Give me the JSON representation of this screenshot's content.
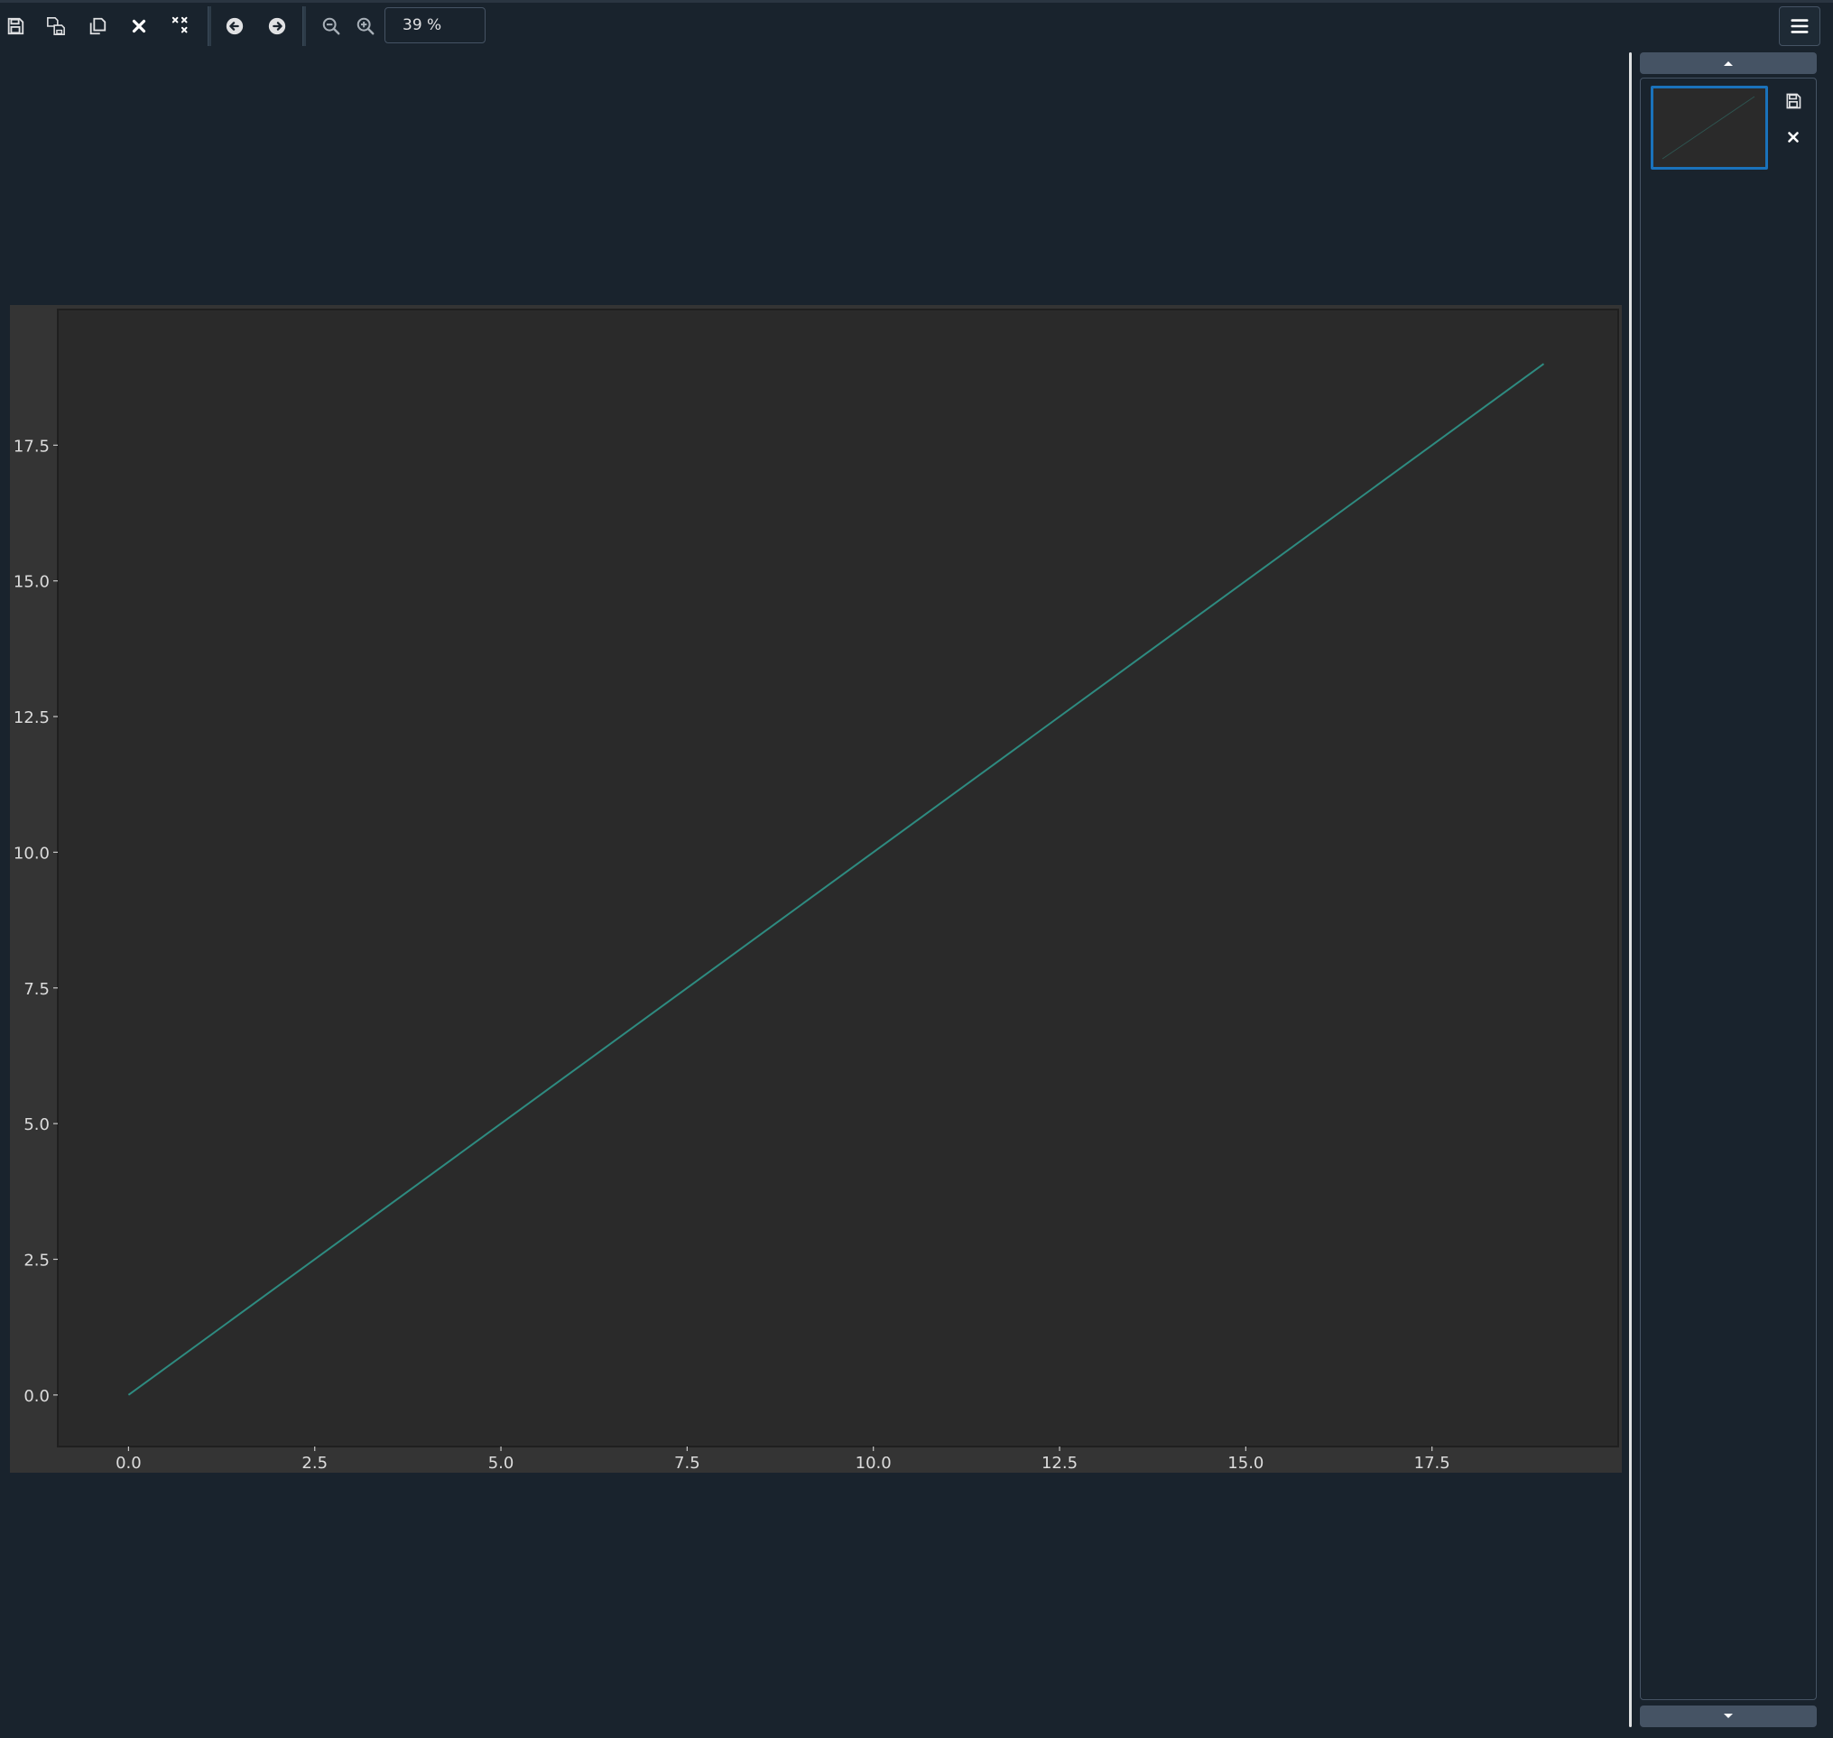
{
  "toolbar": {
    "zoom_value": "39 %",
    "buttons": [
      "save-icon",
      "save-all-icon",
      "copy-icon",
      "close-icon",
      "close-all-icon",
      "arrow-left-icon",
      "arrow-right-icon",
      "zoom-out-icon",
      "zoom-in-icon"
    ]
  },
  "colors": {
    "background": "#19232d",
    "plot_background": "#2a2a2a",
    "line": "#2e8b80",
    "selection": "#1a72bb"
  },
  "chart_data": {
    "type": "line",
    "x": [
      0,
      19
    ],
    "series": [
      {
        "values": [
          0,
          19
        ]
      }
    ],
    "xlim": [
      -0.95,
      20
    ],
    "ylim": [
      -0.95,
      20
    ],
    "xticks": [
      "0.0",
      "2.5",
      "5.0",
      "7.5",
      "10.0",
      "12.5",
      "15.0",
      "17.5"
    ],
    "yticks": [
      "0.0",
      "2.5",
      "5.0",
      "7.5",
      "10.0",
      "12.5",
      "15.0",
      "17.5"
    ],
    "title": "",
    "xlabel": "",
    "ylabel": "",
    "grid": false
  }
}
